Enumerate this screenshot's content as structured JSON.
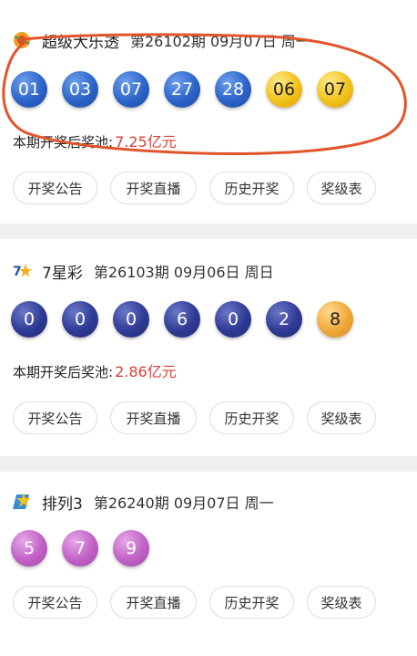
{
  "colors": {
    "pool_amount": "#d9403a",
    "ball_blue": "#2b63c8",
    "ball_gold": "#f2c21a",
    "ball_navy": "#2e3a94",
    "ball_orange": "#f0a83a",
    "ball_purple": "#c160c6",
    "annotation": "#e2552b"
  },
  "lotteries": [
    {
      "logo_icon": "daletou-logo-icon",
      "name": "超级大乐透",
      "meta": "第26102期  09月07日 周一",
      "front_numbers": [
        "01",
        "03",
        "07",
        "27",
        "28"
      ],
      "back_numbers": [
        "06",
        "07"
      ],
      "pool_label": "本期开奖后奖池:",
      "pool_amount": "7.25亿元",
      "buttons": [
        "开奖公告",
        "开奖直播",
        "历史开奖",
        "奖级表"
      ]
    },
    {
      "logo_icon": "qixingcai-logo-icon",
      "name": "7星彩",
      "meta": "第26103期  09月06日 周日",
      "front_numbers": [
        "0",
        "0",
        "0",
        "6",
        "0",
        "2"
      ],
      "back_numbers": [
        "8"
      ],
      "pool_label": "本期开奖后奖池:",
      "pool_amount": "2.86亿元",
      "buttons": [
        "开奖公告",
        "开奖直播",
        "历史开奖",
        "奖级表"
      ]
    },
    {
      "logo_icon": "pailie3-logo-icon",
      "name": "排列3",
      "meta": "第26240期  09月07日 周一",
      "numbers": [
        "5",
        "7",
        "9"
      ],
      "buttons": [
        "开奖公告",
        "开奖直播",
        "历史开奖",
        "奖级表"
      ]
    }
  ]
}
